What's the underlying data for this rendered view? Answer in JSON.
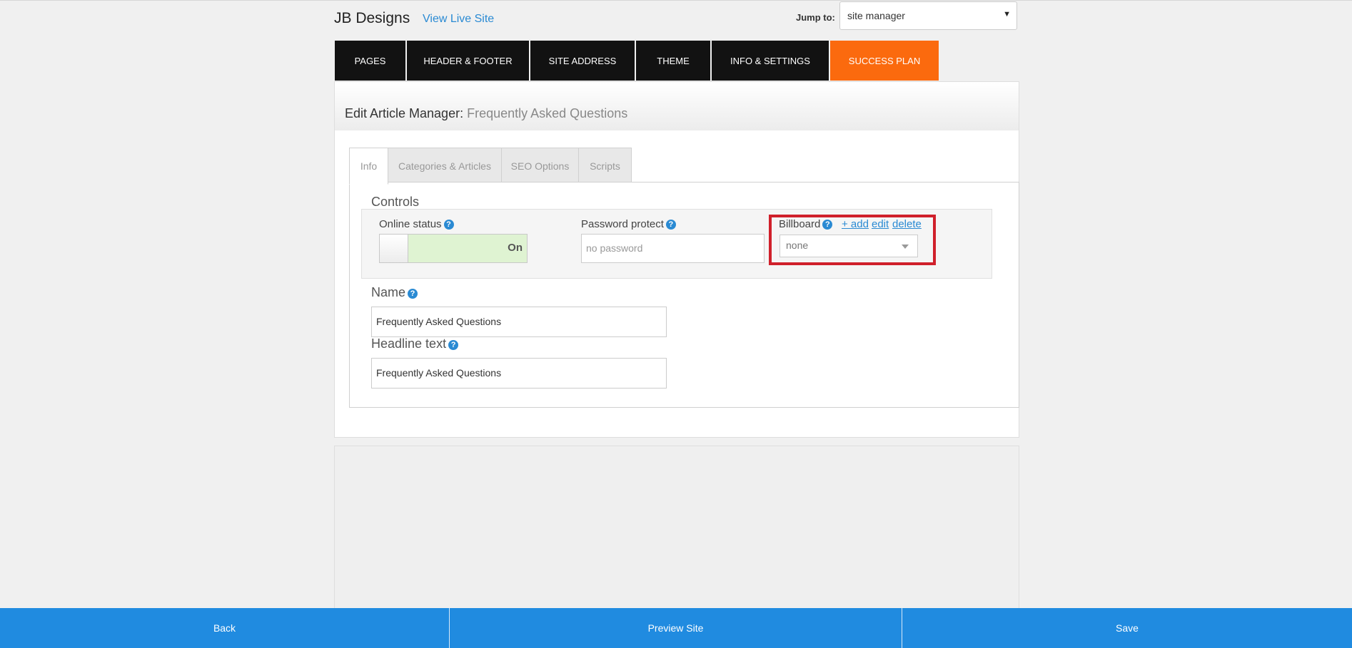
{
  "header": {
    "brand": "JB Designs",
    "view_live_label": "View Live Site",
    "jump_label": "Jump to:",
    "jump_value": "site manager"
  },
  "nav": {
    "items": [
      {
        "label": "PAGES"
      },
      {
        "label": "HEADER & FOOTER"
      },
      {
        "label": "SITE ADDRESS"
      },
      {
        "label": "THEME"
      },
      {
        "label": "INFO & SETTINGS"
      },
      {
        "label": "SUCCESS PLAN",
        "active": true
      }
    ]
  },
  "panel": {
    "title_prefix": "Edit Article Manager:",
    "title_name": "Frequently Asked Questions"
  },
  "tabs": [
    {
      "label": "Info",
      "active": true
    },
    {
      "label": "Categories & Articles"
    },
    {
      "label": "SEO Options"
    },
    {
      "label": "Scripts"
    }
  ],
  "controls": {
    "title": "Controls",
    "online_status": {
      "label": "Online status",
      "value": "On"
    },
    "password": {
      "label": "Password protect",
      "placeholder": "no password"
    },
    "billboard": {
      "label": "Billboard",
      "add_label": "+ add",
      "edit_label": "edit",
      "delete_label": "delete",
      "value": "none"
    }
  },
  "form": {
    "name_label": "Name",
    "name_value": "Frequently Asked Questions",
    "headline_label": "Headline text",
    "headline_value": "Frequently Asked Questions"
  },
  "footer": {
    "back_label": "Back",
    "preview_label": "Preview Site",
    "save_label": "Save"
  },
  "colors": {
    "accent": "#208be0",
    "nav_bg": "#121212",
    "nav_active": "#fb6a0e",
    "highlight": "#d0202b",
    "toggle_on": "#dff3d2"
  },
  "icons": {
    "help": "question-circle-icon",
    "dropdown": "caret-down-icon"
  }
}
